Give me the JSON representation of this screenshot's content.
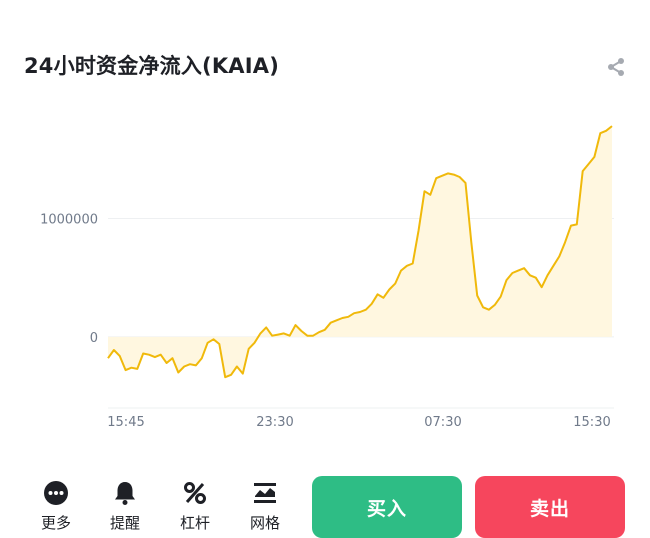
{
  "header": {
    "title": "24小时资金净流入(KAIA)",
    "share_icon": "share-icon"
  },
  "chart_data": {
    "type": "area",
    "title": "24小时资金净流入(KAIA)",
    "xlabel": "",
    "ylabel": "",
    "x_ticks": [
      "15:45",
      "23:30",
      "07:30",
      "15:30"
    ],
    "y_ticks": [
      0,
      1000000
    ],
    "y_tick_labels": [
      "0",
      "1000000"
    ],
    "ylim": [
      -600000,
      2000000
    ],
    "grid": true,
    "line_color": "#f0b90b",
    "fill_color": "#fff7e0",
    "series": [
      {
        "values": [
          -180000,
          -110000,
          -160000,
          -280000,
          -260000,
          -270000,
          -140000,
          -150000,
          -170000,
          -150000,
          -220000,
          -180000,
          -300000,
          -250000,
          -230000,
          -240000,
          -180000,
          -50000,
          -20000,
          -60000,
          -340000,
          -320000,
          -250000,
          -310000,
          -100000,
          -50000,
          30000,
          80000,
          10000,
          20000,
          30000,
          10000,
          100000,
          50000,
          10000,
          10000,
          40000,
          60000,
          120000,
          140000,
          160000,
          170000,
          200000,
          210000,
          230000,
          280000,
          360000,
          330000,
          400000,
          450000,
          560000,
          600000,
          620000,
          900000,
          1230000,
          1200000,
          1340000,
          1360000,
          1380000,
          1370000,
          1350000,
          1300000,
          800000,
          350000,
          250000,
          230000,
          270000,
          340000,
          480000,
          540000,
          560000,
          580000,
          520000,
          500000,
          420000,
          520000,
          600000,
          680000,
          800000,
          940000,
          950000,
          1400000,
          1460000,
          1520000,
          1720000,
          1740000,
          1780000
        ]
      }
    ]
  },
  "actions": [
    {
      "label": "更多",
      "icon": "more-icon"
    },
    {
      "label": "提醒",
      "icon": "bell-icon"
    },
    {
      "label": "杠杆",
      "icon": "percent-icon"
    },
    {
      "label": "网格",
      "icon": "grid-icon"
    }
  ],
  "buy": {
    "label": "买入",
    "color": "#2ebd85"
  },
  "sell": {
    "label": "卖出",
    "color": "#f6465d"
  }
}
